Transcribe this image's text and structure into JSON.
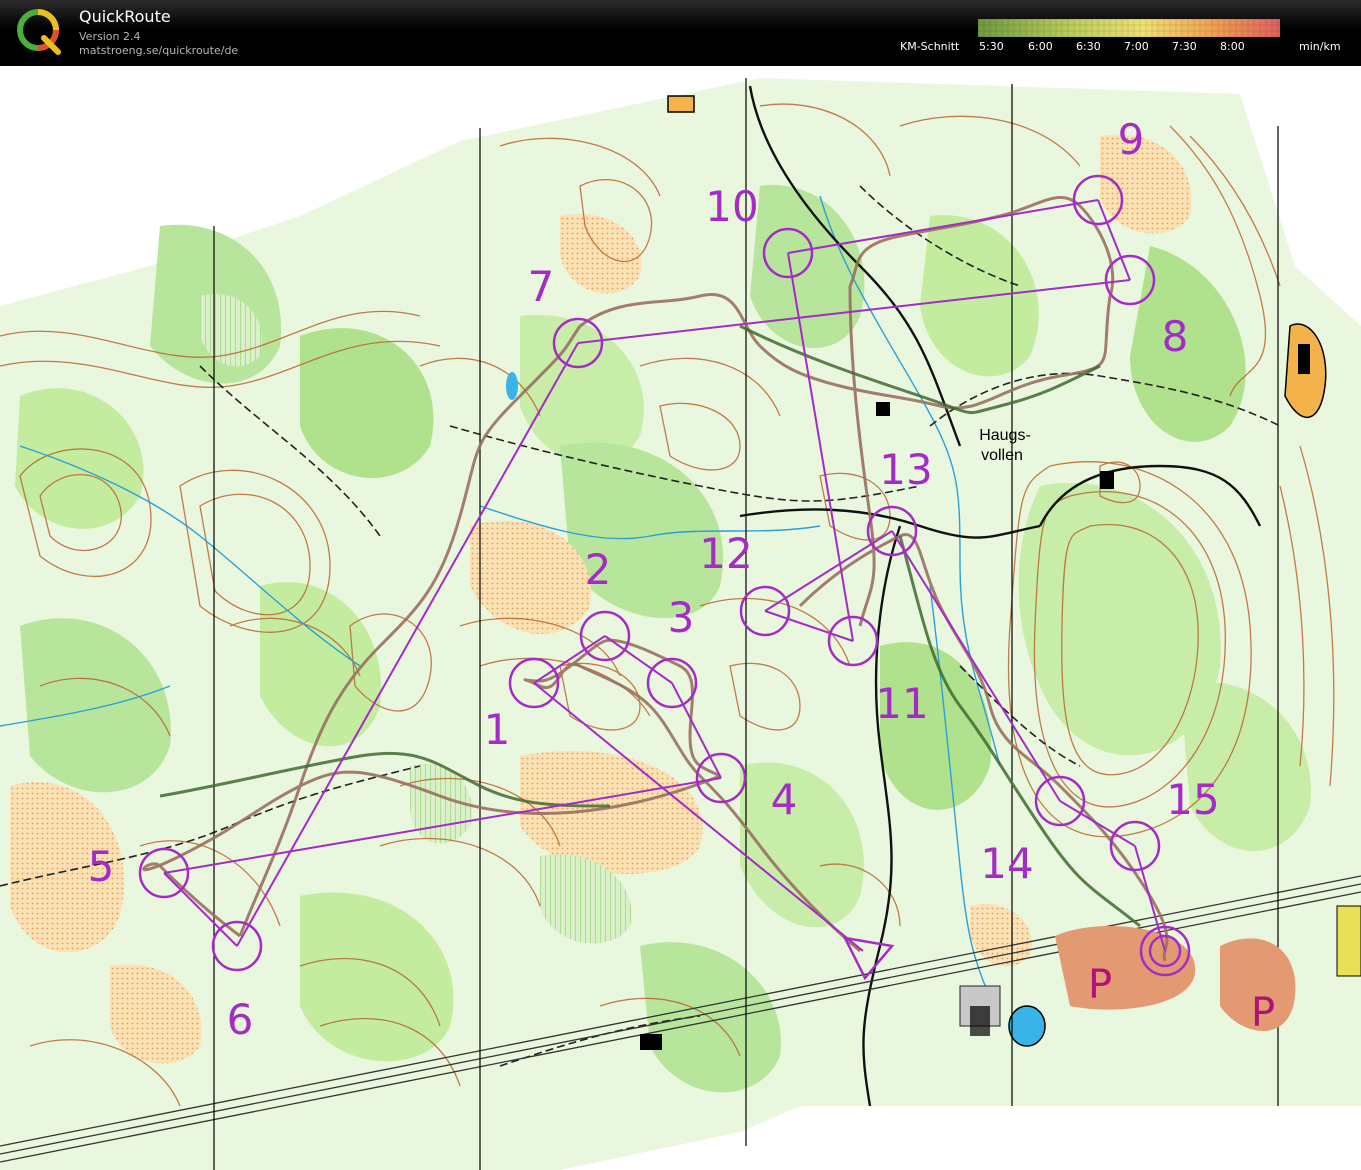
{
  "header": {
    "title": "QuickRoute",
    "version": "Version 2.4",
    "url": "matstroeng.se/quickroute/de",
    "legend_caption": "KM-Schnitt",
    "legend_ticks": [
      "5:30",
      "6:00",
      "6:30",
      "7:00",
      "7:30",
      "8:00"
    ],
    "legend_unit": "min/km",
    "legend_colors": [
      "#6e9a42",
      "#b9cc5a",
      "#f0e070",
      "#f0a050",
      "#e06060"
    ]
  },
  "map": {
    "place_name_line1": "Haugs-",
    "place_name_line2": "vollen",
    "parking_label": "P",
    "course_color": "#a52bc6",
    "route_color": "#9a7060",
    "controls": [
      {
        "number": "1"
      },
      {
        "number": "2"
      },
      {
        "number": "3"
      },
      {
        "number": "4"
      },
      {
        "number": "5"
      },
      {
        "number": "6"
      },
      {
        "number": "7"
      },
      {
        "number": "8"
      },
      {
        "number": "9"
      },
      {
        "number": "10"
      },
      {
        "number": "11"
      },
      {
        "number": "12"
      },
      {
        "number": "13"
      },
      {
        "number": "14"
      },
      {
        "number": "15"
      }
    ]
  }
}
